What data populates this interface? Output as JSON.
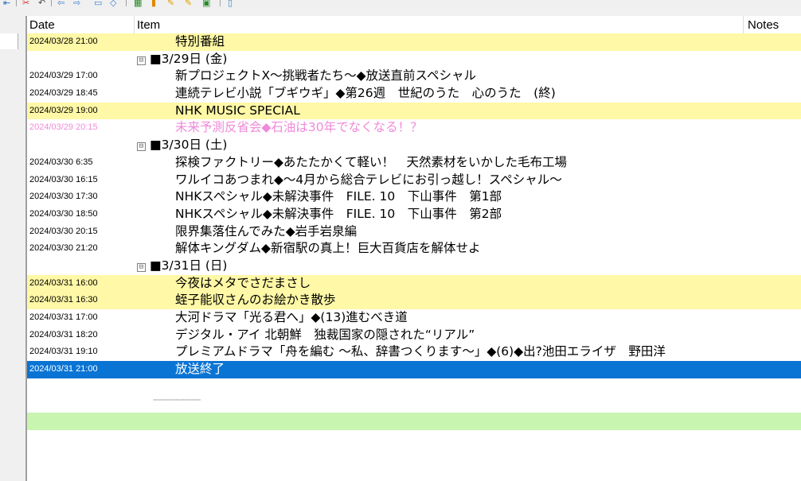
{
  "toolbar": {
    "icons": [
      "back-icon",
      "cut-icon",
      "undo-icon",
      "arrow-left-icon",
      "arrow-right-icon",
      "document-icon",
      "view-icon",
      "calendar-icon",
      "pin-icon",
      "search-icon",
      "search-next-icon",
      "save-icon",
      "page-icon"
    ]
  },
  "list": {
    "columns": [
      {
        "label": "Date"
      },
      {
        "label": "Item"
      },
      {
        "label": "Notes"
      }
    ],
    "rows": [
      {
        "kind": "item",
        "date": "2024/03/28 21:00",
        "title": "特別番組",
        "style": "yellow"
      },
      {
        "kind": "group",
        "label": "■3/29日 (金)",
        "expander": "⊟"
      },
      {
        "kind": "item",
        "date": "2024/03/29 17:00",
        "title": "新プロジェクトX～挑戦者たち～◆放送直前スペシャル",
        "style": ""
      },
      {
        "kind": "item",
        "date": "2024/03/29 18:45",
        "title": "連続テレビ小説「ブギウギ」◆第26週　世紀のうた　心のうた　(終)",
        "style": ""
      },
      {
        "kind": "item",
        "date": "2024/03/29 19:00",
        "title": "NHK MUSIC SPECIAL",
        "style": "yellow"
      },
      {
        "kind": "item",
        "date": "2024/03/29 20:15",
        "title": "未来予測反省会◆石油は30年でなくなる！？",
        "style": "pink"
      },
      {
        "kind": "group",
        "label": "■3/30日 (土)",
        "expander": "⊟"
      },
      {
        "kind": "item",
        "date": "2024/03/30 6:35",
        "title": "探検ファクトリー◆あたたかくて軽い！　天然素材をいかした毛布工場",
        "style": ""
      },
      {
        "kind": "item",
        "date": "2024/03/30 16:15",
        "title": "ワルイコあつまれ◆～4月から総合テレビにお引っ越し！スペシャル～",
        "style": ""
      },
      {
        "kind": "item",
        "date": "2024/03/30 17:30",
        "title": "NHKスペシャル◆未解決事件　FILE. 10　下山事件　第1部",
        "style": ""
      },
      {
        "kind": "item",
        "date": "2024/03/30 18:50",
        "title": "NHKスペシャル◆未解決事件　FILE. 10　下山事件　第2部",
        "style": ""
      },
      {
        "kind": "item",
        "date": "2024/03/30 20:15",
        "title": "限界集落住んでみた◆岩手岩泉編",
        "style": ""
      },
      {
        "kind": "item",
        "date": "2024/03/30 21:20",
        "title": "解体キングダム◆新宿駅の真上！巨大百貨店を解体せよ",
        "style": ""
      },
      {
        "kind": "group",
        "label": "■3/31日 (日)",
        "expander": "⊟"
      },
      {
        "kind": "item",
        "date": "2024/03/31 16:00",
        "title": "今夜はメタでさだまさし",
        "style": "yellow"
      },
      {
        "kind": "item",
        "date": "2024/03/31 16:30",
        "title": "蛭子能収さんのお絵かき散歩",
        "style": "yellow"
      },
      {
        "kind": "item",
        "date": "2024/03/31 17:00",
        "title": "大河ドラマ「光る君へ」◆(13)進むべき道",
        "style": ""
      },
      {
        "kind": "item",
        "date": "2024/03/31 18:20",
        "title": "デジタル・アイ 北朝鮮　独裁国家の隠された“リアル”",
        "style": ""
      },
      {
        "kind": "item",
        "date": "2024/03/31 19:10",
        "title": "プレミアムドラマ「舟を編む ～私、辞書つくります～」◆(6)◆出?池田エライザ　野田洋",
        "style": ""
      },
      {
        "kind": "item",
        "date": "2024/03/31 21:00",
        "title": "放送終了",
        "style": "sel"
      },
      {
        "kind": "blank",
        "style": ""
      },
      {
        "kind": "dots",
        "style": ""
      },
      {
        "kind": "blank",
        "style": "green"
      }
    ]
  }
}
